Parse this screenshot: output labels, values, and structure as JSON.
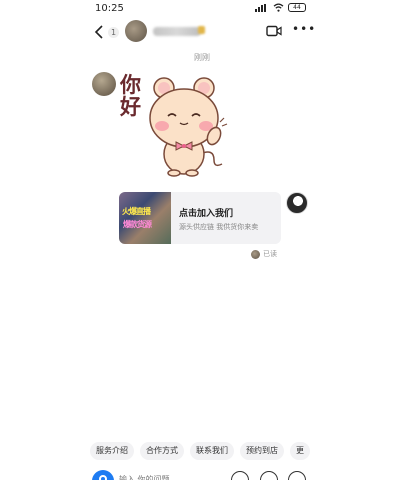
{
  "status_bar": {
    "time": "10:25",
    "battery": "44"
  },
  "header": {
    "unread_count": "1"
  },
  "chat": {
    "timestamp": "刚刚",
    "sticker_text": "你好",
    "card": {
      "title": "点击加入我们",
      "subtitle": "源头供应链 我供货你来卖",
      "thumb_line1": "火爆直播",
      "thumb_line2": "爆款货源"
    },
    "read_status": "已读"
  },
  "quick_replies": [
    "服务介绍",
    "合作方式",
    "联系我们",
    "预约到店",
    "更"
  ],
  "input": {
    "placeholder": "输入 你的问题"
  },
  "colors": {
    "accent": "#1e7cf2",
    "bubble": "#f2f2f4",
    "sticker_mouse": "#fbe1c8"
  }
}
